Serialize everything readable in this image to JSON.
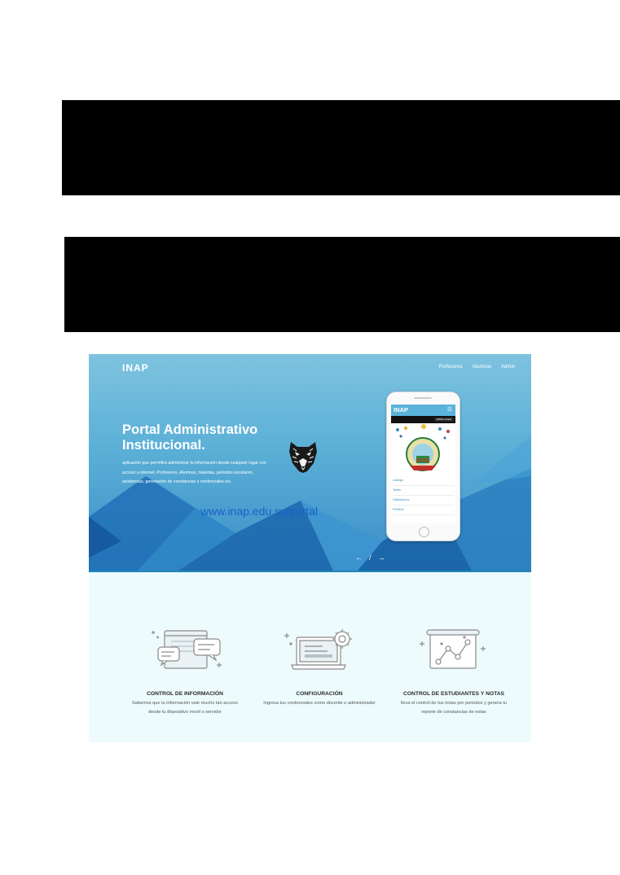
{
  "brand": "INAP",
  "nav": [
    "Profesores",
    "Alumnos",
    "Admin"
  ],
  "hero": {
    "title": "Portal Administrativo Institucional.",
    "description": "aplicación que permitirá administrar tu información desde cualquier lugar con acceso a internet, Profesores, Alumnos, materias, periodos escolares, asistencias, generación de constancias y credenciales etc.",
    "url": "www.inap.edu.sv/portal",
    "prev": "←",
    "divider": "/",
    "next": "→"
  },
  "phone": {
    "brand": "INAP",
    "menu_icon": "menu-icon",
    "user_button": "ADMIN / usuario",
    "menu_items": [
      "Catálogo",
      "Tareas",
      "Calificaciones",
      "Perfil/Info"
    ]
  },
  "features": [
    {
      "icon": "chat-window-icon",
      "title": "CONTROL DE INFORMACIÓN",
      "description": "Sabemos que tu información vale mucho tan acceso desde tu dispositivo movil o servidor"
    },
    {
      "icon": "laptop-gear-icon",
      "title": "CONFIGURACIÓN",
      "description": "Ingresa tus credenciales como docente o administrador"
    },
    {
      "icon": "chart-board-icon",
      "title": "CONTROL DE ESTUDIANTES Y NOTAS",
      "description": "lleva el control de tus notas por periodos y genera tu reporte de constancias de notas"
    }
  ],
  "colors": {
    "hero_top": "#7ec3df",
    "hero_bottom": "#3b8ec8",
    "url": "#1c5fc9",
    "features_bg": "#eefbfc",
    "separator": "#1f86b8"
  }
}
